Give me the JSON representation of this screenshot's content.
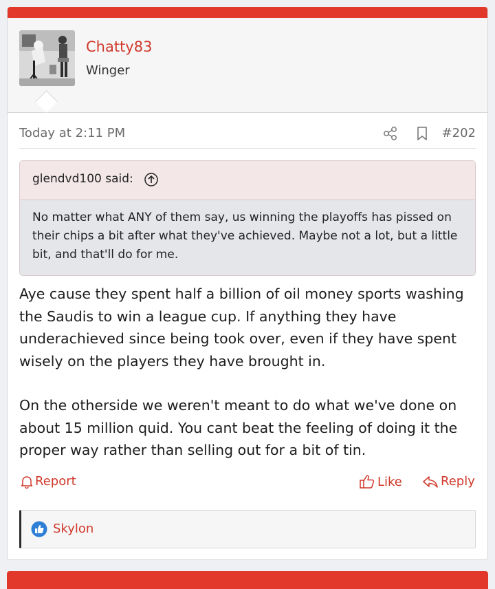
{
  "post": {
    "username": "Chatty83",
    "user_title": "Winger",
    "date": "Today at 2:11 PM",
    "post_number": "#202",
    "quote": {
      "author_label": "glendvd100 said:",
      "text": "No matter what ANY of them say, us winning the playoffs has pissed on their chips a bit after what they've achieved. Maybe not a lot, but a little bit, and that'll do for me."
    },
    "message": {
      "paragraph1": "Aye cause they spent half a billion of oil money sports washing the Saudis to win a league cup. If anything they have underachieved since being took over, even if they have spent wisely on the players they have brought in.",
      "paragraph2": "On the otherside we weren't meant to do what we've done on about 15 million quid. You cant beat the feeling of doing it the proper way rather than selling out for a bit of tin."
    },
    "actions": {
      "report_label": "Report",
      "like_label": "Like",
      "reply_label": "Reply"
    },
    "reactions": {
      "user": "Skylon",
      "icon": "like-reaction-icon"
    }
  },
  "colors": {
    "accent": "#e2382b",
    "link": "#d0392b",
    "quote_head_bg": "#f3e7e8",
    "quote_body_bg": "#e4e6ea",
    "like_reaction": "#2f7fd7"
  },
  "icons": {
    "share": "share-icon",
    "bookmark": "bookmark-icon",
    "quote_jump": "arrow-up-circle-icon",
    "report": "bell-icon",
    "like": "thumbs-up-icon",
    "reply": "reply-arrow-icon"
  }
}
